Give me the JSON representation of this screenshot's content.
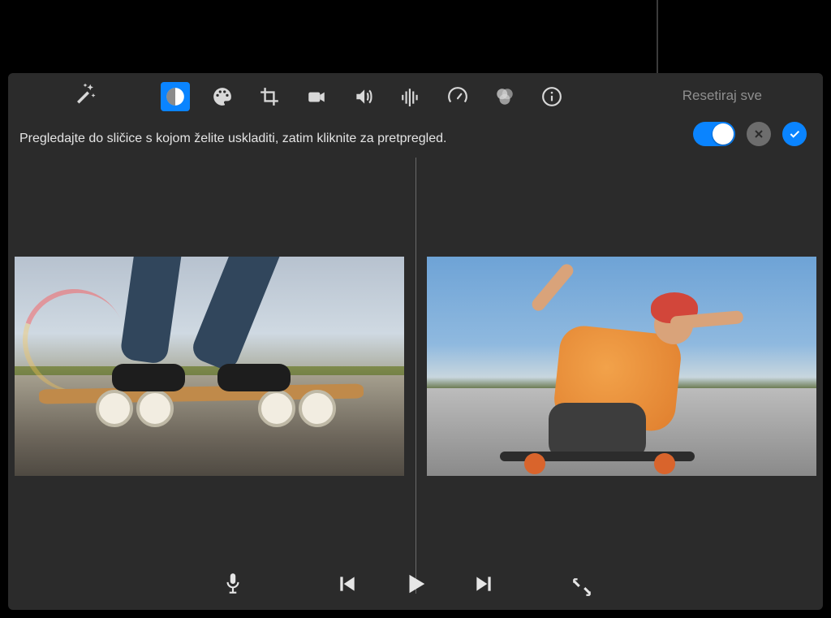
{
  "header": {
    "reset_label": "Resetiraj sve"
  },
  "instruction_text": "Pregledajte do sličice s kojom želite uskladiti, zatim kliknite za pretpregled.",
  "toolbar": {
    "magic_wand": "magic-wand",
    "items": [
      {
        "name": "color-balance",
        "active": true
      },
      {
        "name": "color-correction",
        "active": false
      },
      {
        "name": "crop",
        "active": false
      },
      {
        "name": "stabilization",
        "active": false
      },
      {
        "name": "volume",
        "active": false
      },
      {
        "name": "noise-reduction",
        "active": false
      },
      {
        "name": "speed",
        "active": false
      },
      {
        "name": "filters",
        "active": false
      },
      {
        "name": "info",
        "active": false
      }
    ]
  },
  "controls": {
    "toggle_on": true
  },
  "transport": {
    "mic": "microphone",
    "prev": "previous-frame",
    "play": "play",
    "next": "next-frame",
    "fullscreen": "fullscreen"
  }
}
